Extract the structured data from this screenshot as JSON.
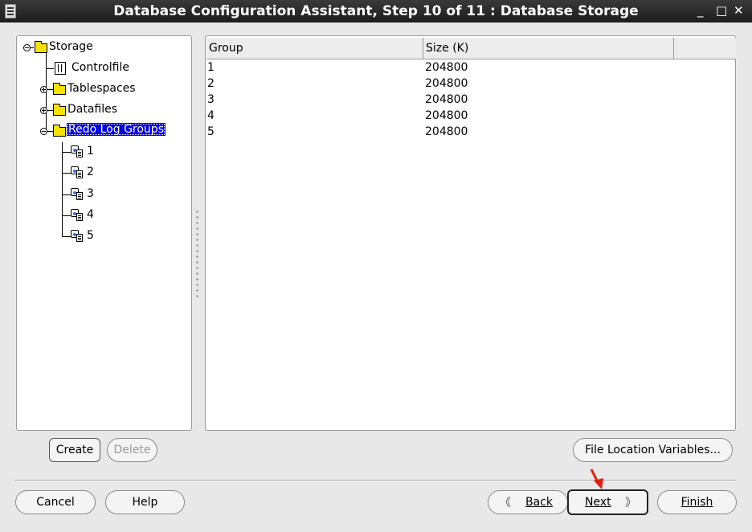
{
  "window": {
    "title": "Database Configuration Assistant, Step 10 of 11 : Database Storage",
    "minimize": "_",
    "maximize": "□",
    "close": "✕"
  },
  "tree": {
    "root": "Storage",
    "items": [
      {
        "label": "Controlfile"
      },
      {
        "label": "Tablespaces"
      },
      {
        "label": "Datafiles"
      },
      {
        "label": "Redo Log Groups",
        "children": [
          "1",
          "2",
          "3",
          "4",
          "5"
        ]
      }
    ]
  },
  "table": {
    "columns": [
      "Group",
      "Size (K)"
    ],
    "rows": [
      [
        "1",
        "204800"
      ],
      [
        "2",
        "204800"
      ],
      [
        "3",
        "204800"
      ],
      [
        "4",
        "204800"
      ],
      [
        "5",
        "204800"
      ]
    ]
  },
  "buttons": {
    "create": "Create",
    "delete": "Delete",
    "file_location_variables": "File Location Variables...",
    "cancel": "Cancel",
    "help": "Help",
    "back": "Back",
    "next": "Next",
    "finish": "Finish",
    "back_arrow": "《",
    "next_arrow": "》"
  },
  "colors": {
    "selection": "#0000e0",
    "folder": "#f6e200",
    "annotation_arrow": "#e02010"
  }
}
